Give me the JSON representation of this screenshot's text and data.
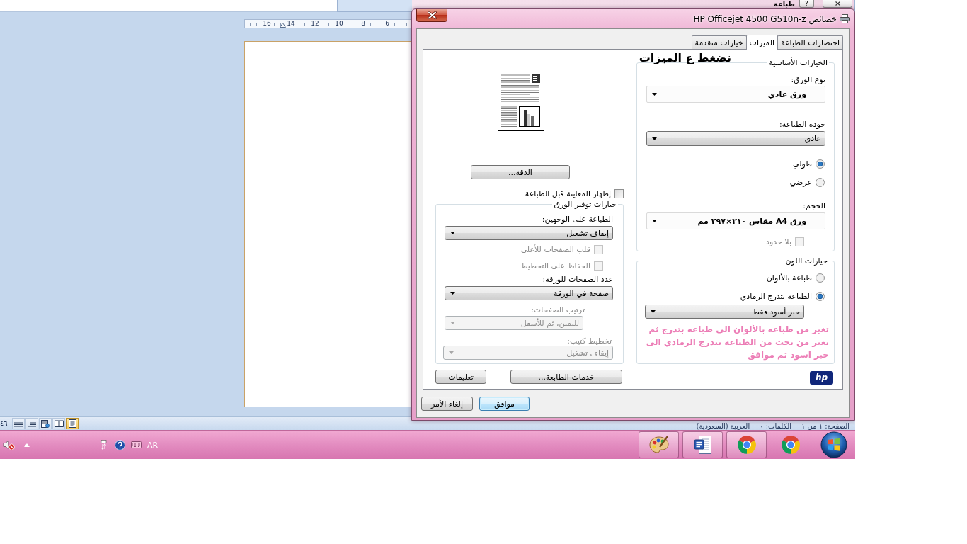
{
  "word_window": {
    "ruler": {
      "labels": [
        "6",
        "8",
        "10",
        "12",
        "14",
        "16"
      ]
    },
    "status_bar": {
      "zoom": "٤٦",
      "view_buttons": [
        {
          "kind": "draft",
          "selected": false
        },
        {
          "kind": "outline",
          "selected": false
        },
        {
          "kind": "web",
          "selected": false
        },
        {
          "kind": "reading",
          "selected": false
        },
        {
          "kind": "print",
          "selected": true
        }
      ],
      "fields": [
        "الصفحة: ١ من ١",
        "الكلمات: ٠",
        "العربية (السعودية)"
      ]
    }
  },
  "print_window": {
    "title": "طباعة",
    "help_button": "?"
  },
  "dialog": {
    "title": "خصائص HP Officejet 4500 G510n-z",
    "tabs": [
      {
        "label": "اختصارات الطباعة",
        "selected": false
      },
      {
        "label": "الميزات",
        "selected": true
      },
      {
        "label": "خيارات متقدمة",
        "selected": false
      }
    ],
    "basic_options": {
      "title": "الخيارات الأساسية",
      "paper_type": {
        "label": "نوع الورق:",
        "value": "ورق عادي"
      },
      "print_quality": {
        "label": "جودة الطباعة:",
        "value": "عادي"
      },
      "orientation": [
        {
          "label": "طولي",
          "selected": true
        },
        {
          "label": "عرضي",
          "selected": false
        }
      ],
      "size": {
        "label": "الحجم:",
        "value": "ورق A4 مقاس ٢١٠×٢٩٧ مم"
      },
      "borderless": {
        "label": "بلا حدود",
        "checked": false,
        "disabled": true
      }
    },
    "color_options": {
      "title": "خيارات اللون",
      "modes": [
        {
          "label": "طباعة بالألوان",
          "selected": false
        },
        {
          "label": "الطباعة بتدرج الرمادي",
          "selected": true
        }
      ],
      "grayscale_ink": {
        "value": "حبر أسود فقط"
      }
    },
    "logo": "hp",
    "resolution_button": "الدقة...",
    "show_preview": {
      "label": "إظهار المعاينة قبل الطباعة",
      "checked": false
    },
    "paper_saving": {
      "title": "خيارات توفير الورق",
      "duplex": {
        "label": "الطباعة على الوجهين:",
        "value": "إيقاف تشغيل",
        "disabled": false
      },
      "duplex_options": [
        {
          "label": "قلب الصفحات للأعلى",
          "checked": false,
          "disabled": true
        },
        {
          "label": "الحفاظ على التخطيط",
          "checked": false,
          "disabled": true
        }
      ],
      "pages_per_sheet": {
        "label": "عدد الصفحات للورقة:",
        "value": "صفحة في الورقة",
        "disabled": false
      },
      "page_order": {
        "label": "ترتيب الصفحات:",
        "value": "لليمين، ثم للأسفل",
        "disabled": true
      },
      "booklet": {
        "label": "تخطيط كتيب:",
        "value": "إيقاف تشغيل",
        "disabled": true
      }
    },
    "printer_services_button": "خدمات الطابعة...",
    "help_button": "تعليمات",
    "ok_button": "موافق",
    "cancel_button": "إلغاء الأمر"
  },
  "annotations": {
    "tab_hint": "نضغط ع الميزات",
    "color_hint": "تغير من طباعه بالألوان الى طباعه بتدرج ثم تغير من تحت من الطباعه بتدرج الرمادي الى حبر اسود ثم موافق"
  },
  "taskbar": {
    "language": "AR",
    "apps": [
      {
        "kind": "paint",
        "running": true
      },
      {
        "kind": "word",
        "running": true
      },
      {
        "kind": "browser",
        "running": true
      },
      {
        "kind": "browser",
        "running": false
      }
    ]
  }
}
